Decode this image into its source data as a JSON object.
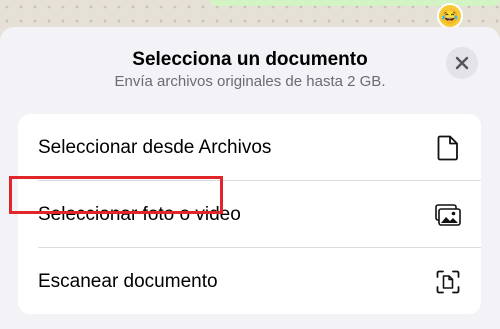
{
  "background": {
    "emoji": "😂"
  },
  "sheet": {
    "title": "Selecciona un documento",
    "subtitle": "Envía archivos originales de hasta 2 GB.",
    "close_icon": "close-icon"
  },
  "options": [
    {
      "label": "Seleccionar desde Archivos",
      "icon": "document-icon"
    },
    {
      "label": "Seleccionar foto o video",
      "icon": "photo-gallery-icon"
    },
    {
      "label": "Escanear documento",
      "icon": "scan-document-icon"
    }
  ],
  "colors": {
    "highlight": "#e0262b",
    "sheet_background": "#f2f2f7",
    "card_background": "#ffffff"
  }
}
